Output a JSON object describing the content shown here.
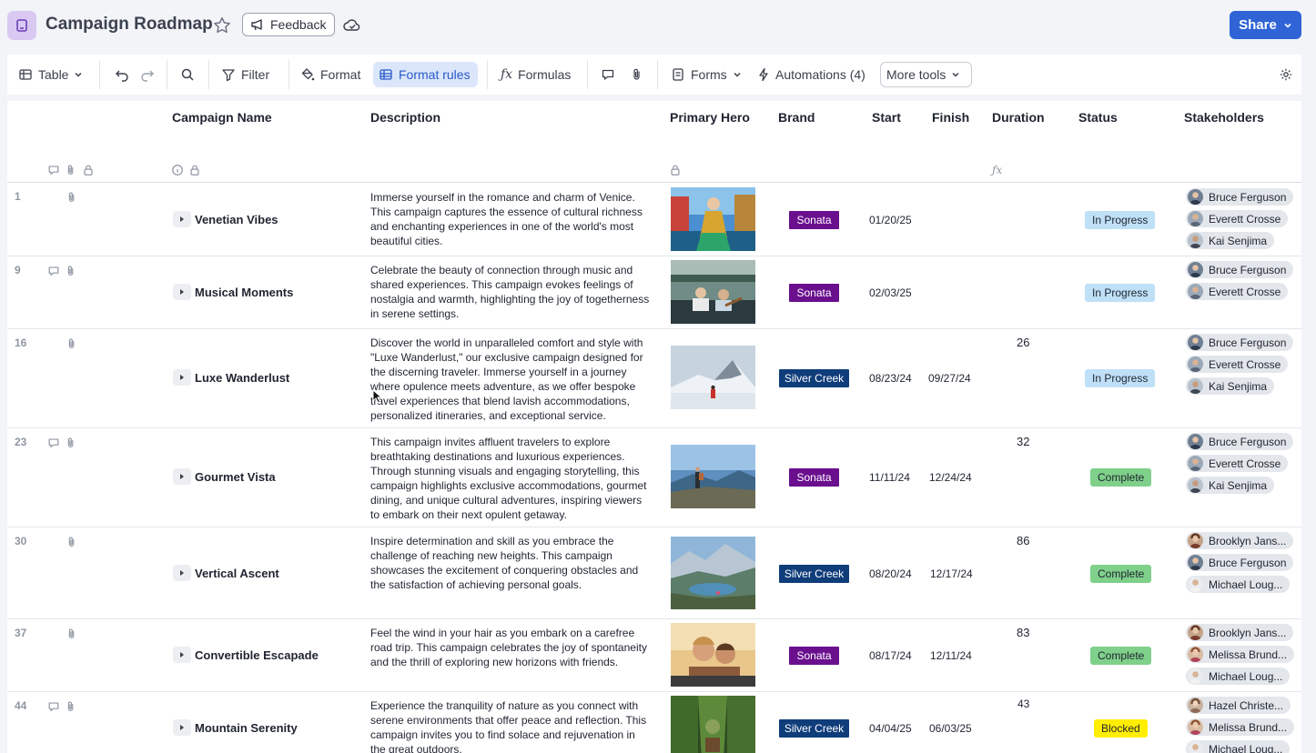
{
  "header": {
    "title": "Campaign Roadmap",
    "feedback_label": "Feedback",
    "share_label": "Share"
  },
  "toolbar": {
    "view_label": "Table",
    "filter_label": "Filter",
    "format_label": "Format",
    "format_rules_label": "Format rules",
    "formulas_label": "Formulas",
    "forms_label": "Forms",
    "automations_label": "Automations (4)",
    "more_tools_label": "More tools"
  },
  "columns": {
    "campaign_name": "Campaign Name",
    "description": "Description",
    "primary_hero": "Primary Hero",
    "brand": "Brand",
    "start": "Start",
    "finish": "Finish",
    "duration": "Duration",
    "status": "Status",
    "stakeholders": "Stakeholders"
  },
  "colors": {
    "sonata": "#6a0f8e",
    "silver_creek": "#0f3d7a",
    "in_progress": "#bfe0f7",
    "complete": "#7fd08a",
    "blocked": "#ffee00",
    "accent": "#2f63d6"
  },
  "rows": [
    {
      "num": "1",
      "name": "Venetian Vibes",
      "description": "Immerse yourself in the romance and charm of Venice. This campaign captures the essence of cultural richness and enchanting experiences in one of the world's most beautiful cities.",
      "brand": "Sonata",
      "start": "01/20/25",
      "finish": "",
      "duration": "",
      "status": "In Progress",
      "stakeholders": [
        "Bruce Ferguson",
        "Everett Crosse",
        "Kai Senjima"
      ]
    },
    {
      "num": "9",
      "name": "Musical Moments",
      "description": "Celebrate the beauty of connection through music and shared experiences. This campaign evokes feelings of nostalgia and warmth, highlighting the joy of togetherness in serene settings.",
      "brand": "Sonata",
      "start": "02/03/25",
      "finish": "",
      "duration": "",
      "status": "In Progress",
      "stakeholders": [
        "Bruce Ferguson",
        "Everett Crosse"
      ]
    },
    {
      "num": "16",
      "name": "Luxe Wanderlust",
      "description": "Discover the world in unparalleled comfort and style with \"Luxe Wanderlust,\" our exclusive campaign designed for the discerning traveler. Immerse yourself in a journey where opulence meets adventure, as we offer bespoke travel experiences that blend lavish accommodations, personalized itineraries, and exceptional service.",
      "brand": "Silver Creek",
      "start": "08/23/24",
      "finish": "09/27/24",
      "duration": "26",
      "status": "In Progress",
      "stakeholders": [
        "Bruce Ferguson",
        "Everett Crosse",
        "Kai Senjima"
      ]
    },
    {
      "num": "23",
      "name": "Gourmet Vista",
      "description": "This campaign invites affluent travelers to explore breathtaking destinations and luxurious experiences. Through stunning visuals and engaging storytelling, this campaign highlights exclusive accommodations, gourmet dining, and unique cultural adventures, inspiring viewers to embark on their next opulent getaway.",
      "brand": "Sonata",
      "start": "11/11/24",
      "finish": "12/24/24",
      "duration": "32",
      "status": "Complete",
      "stakeholders": [
        "Bruce Ferguson",
        "Everett Crosse",
        "Kai Senjima"
      ]
    },
    {
      "num": "30",
      "name": "Vertical Ascent",
      "description": "Inspire determination and skill as you embrace the challenge of reaching new heights. This campaign showcases the excitement of conquering obstacles and the satisfaction of achieving personal goals.",
      "brand": "Silver Creek",
      "start": "08/20/24",
      "finish": "12/17/24",
      "duration": "86",
      "status": "Complete",
      "stakeholders": [
        "Brooklyn Jans...",
        "Bruce Ferguson",
        "Michael Loug..."
      ]
    },
    {
      "num": "37",
      "name": "Convertible Escapade",
      "description": "Feel the wind in your hair as you embark on a carefree road trip. This campaign celebrates the joy of spontaneity and the thrill of exploring new horizons with friends.",
      "brand": "Sonata",
      "start": "08/17/24",
      "finish": "12/11/24",
      "duration": "83",
      "status": "Complete",
      "stakeholders": [
        "Brooklyn Jans...",
        "Melissa Brund...",
        "Michael Loug..."
      ]
    },
    {
      "num": "44",
      "name": "Mountain Serenity",
      "description": "Experience the tranquility of nature as you connect with serene environments that offer peace and reflection. This campaign invites you to find solace and rejuvenation in the great outdoors.",
      "brand": "Silver Creek",
      "start": "04/04/25",
      "finish": "06/03/25",
      "duration": "43",
      "status": "Blocked",
      "stakeholders": [
        "Hazel Christe...",
        "Melissa Brund...",
        "Michael Loug..."
      ]
    }
  ]
}
